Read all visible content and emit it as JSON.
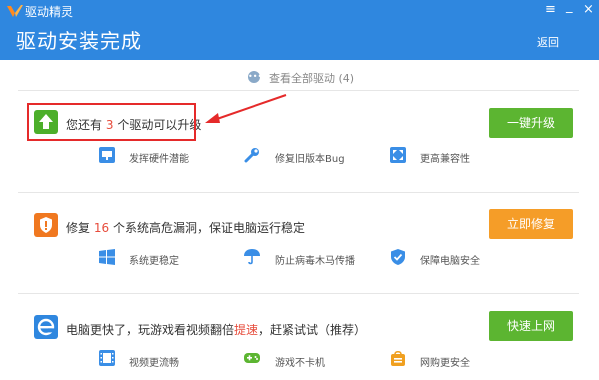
{
  "window": {
    "app_name": "驱动精灵",
    "menu_icon": "≡",
    "minimize_icon": "_",
    "close_icon": "×"
  },
  "header": {
    "title": "驱动安装完成",
    "back_label": "返回"
  },
  "view_all": {
    "label": "查看全部驱动 (4)"
  },
  "cards": [
    {
      "title_prefix": "您还有",
      "title_count": "3",
      "title_suffix": "个驱动可以升级",
      "button_label": "一键升级",
      "icon": "upload-arrow-icon",
      "features": [
        {
          "label": "发挥硬件潜能",
          "icon": "monitor-icon"
        },
        {
          "label": "修复旧版本Bug",
          "icon": "wrench-icon"
        },
        {
          "label": "更高兼容性",
          "icon": "expand-icon"
        }
      ]
    },
    {
      "title_prefix": "修复",
      "title_count": "16",
      "title_suffix": "个系统高危漏洞，保证电脑运行稳定",
      "button_label": "立即修复",
      "icon": "shield-alert-icon",
      "features": [
        {
          "label": "系统更稳定",
          "icon": "windows-icon"
        },
        {
          "label": "防止病毒木马传播",
          "icon": "umbrella-icon"
        },
        {
          "label": "保障电脑安全",
          "icon": "shield-check-icon"
        }
      ]
    },
    {
      "title_prefix": "电脑更快了，玩游戏看视频翻倍",
      "title_highlight": "提速",
      "title_suffix": "，赶紧试试（推荐）",
      "button_label": "快速上网",
      "icon": "ie-icon",
      "features": [
        {
          "label": "视频更流畅",
          "icon": "film-icon"
        },
        {
          "label": "游戏不卡机",
          "icon": "gamepad-icon"
        },
        {
          "label": "网购更安全",
          "icon": "shopping-bag-icon"
        }
      ]
    }
  ],
  "colors": {
    "header_bg": "#2f87df",
    "green_button": "#5cb531",
    "orange_button": "#f59d28",
    "highlight_red": "#e52a2a"
  }
}
